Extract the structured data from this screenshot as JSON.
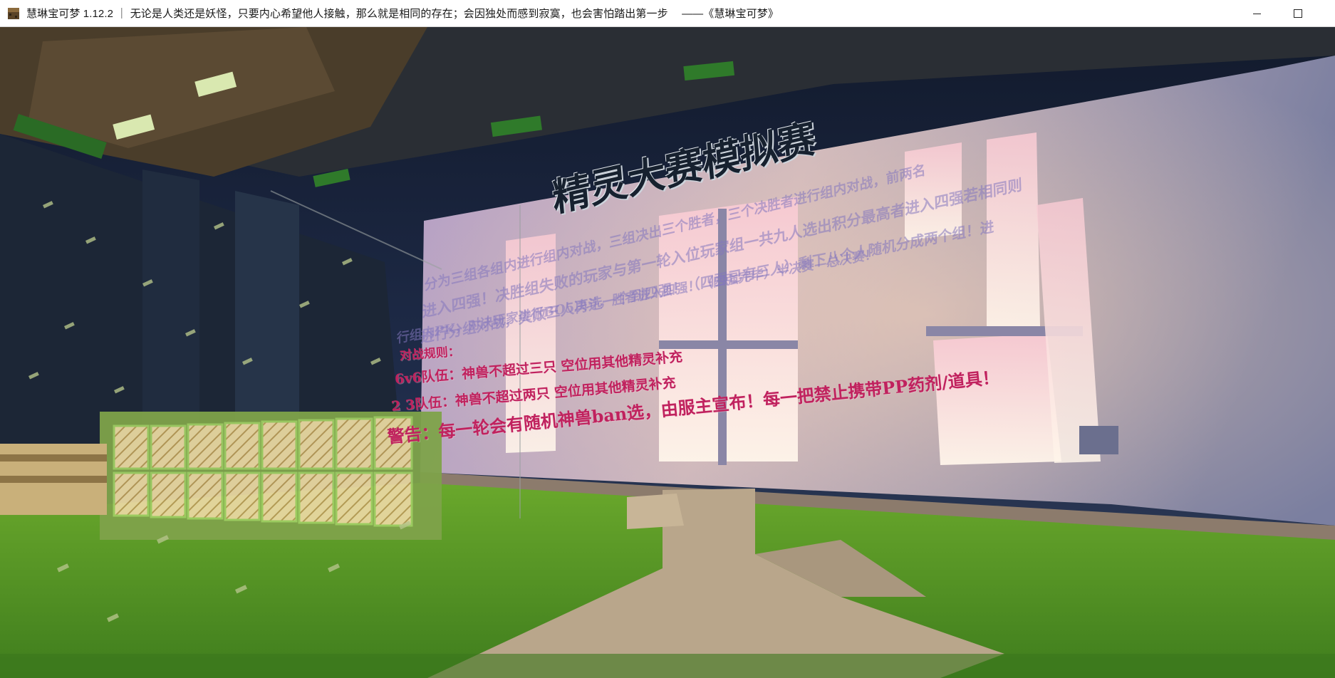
{
  "window": {
    "title": "慧琳宝可梦 1.12.2 ｜ 无论是人类还是妖怪，只要内心希望他人接触，那么就是相同的存在；会因独处而感到寂寞，也会害怕踏出第一步 　——《慧琳宝可梦》",
    "icon": "minecraft-grass-block-icon",
    "controls": [
      "minimize-icon",
      "maximize-icon"
    ]
  },
  "scene": {
    "billboard": {
      "title": "精灵大赛模拟赛",
      "intro_lines": [
        "分为三组各组内进行组内对战，三组决出三个胜者，三个决胜者进行组内对战，前两名",
        "进入四强！决胜组失败的玩家与第一轮入位玩家组一共九人选出积分最高者进入四强若相同则",
        "进行分组对战，失败三人再选一个到四强！（四强已有三人）剩下八个人随机分成两个组！进",
        "行组内PK，对决玩家进行BO5决斗，胜者进入四强！（四强完毕）半决赛—总决赛！"
      ],
      "rules_heading": "对战规则：",
      "rules": [
        "6v6队伍：神兽不超过三只 空位用其他精灵补充",
        "2 3队伍：神兽不超过两只 空位用其他精灵补充"
      ],
      "warning": "警告：每一轮会有随机神兽ban选，由服主宣布！每一把禁止携带PP药剂/道具！"
    },
    "colors": {
      "sky": "#1d2b4a",
      "wall": "#b9a2b6",
      "window_glow": "#f6e3dd",
      "grass": "#5a9a2a",
      "path": "#b8a48a",
      "rule_text": "#c0225e"
    }
  }
}
